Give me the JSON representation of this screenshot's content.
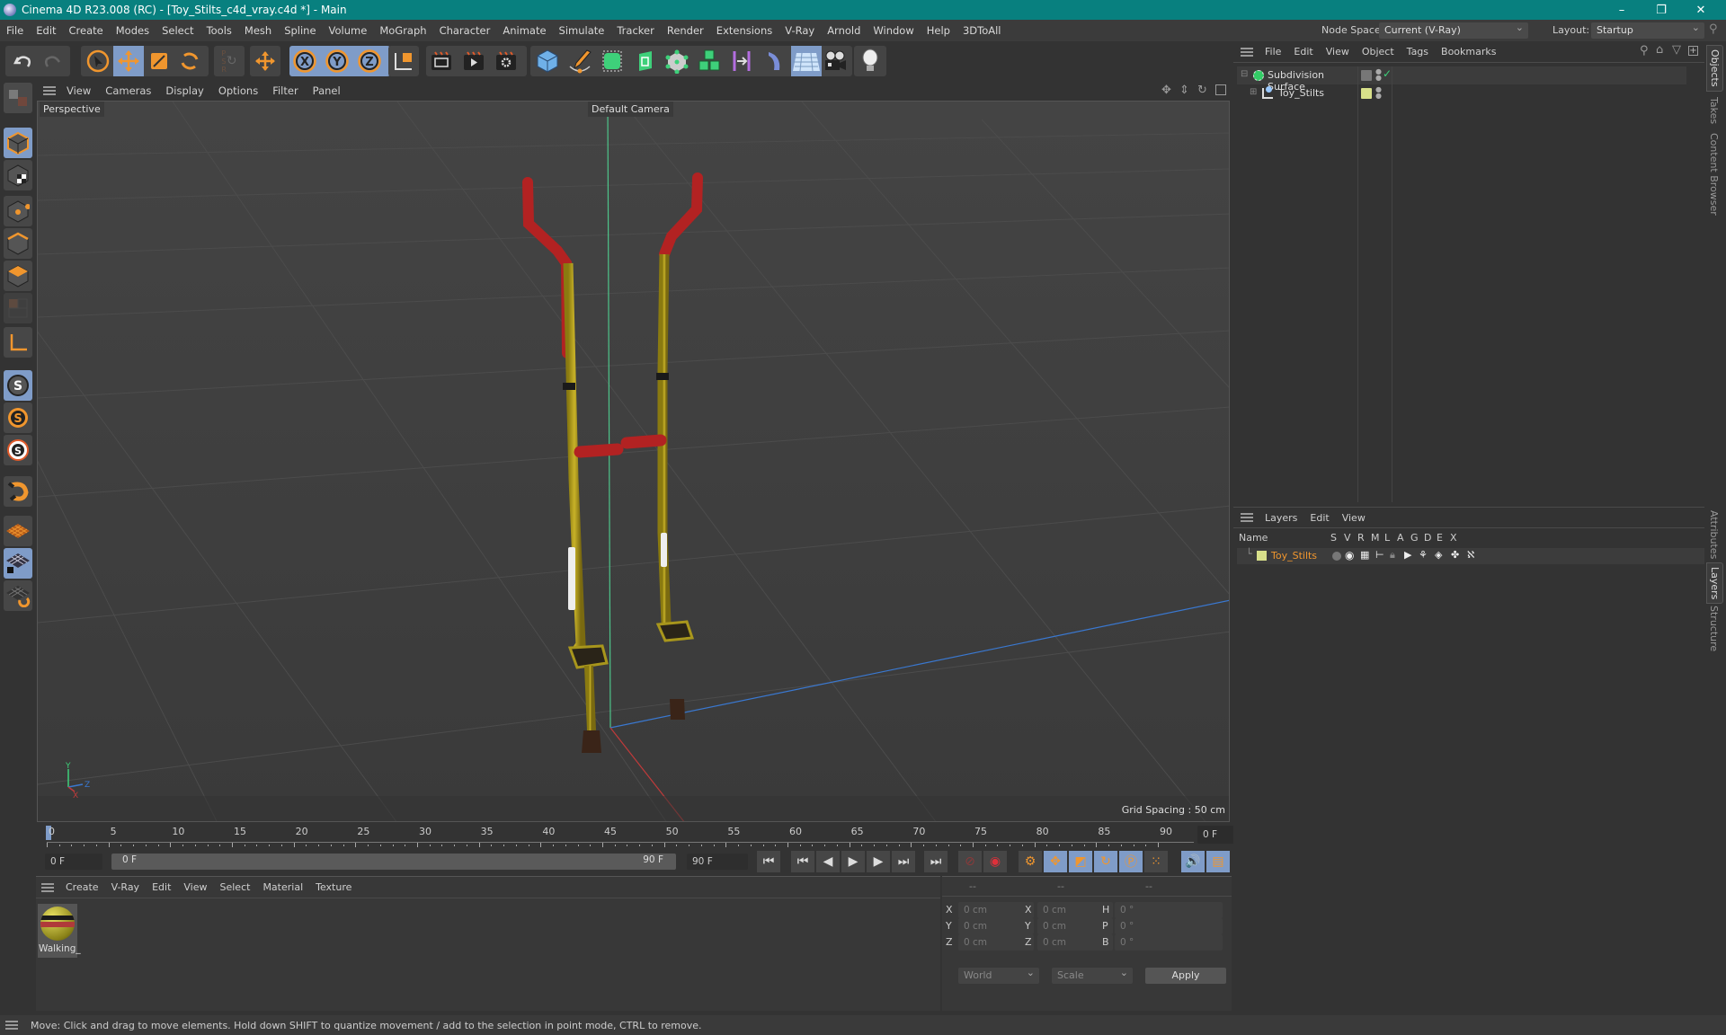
{
  "titlebar": {
    "title": "Cinema 4D R23.008 (RC) - [Toy_Stilts_c4d_vray.c4d *] - Main",
    "minimize": "–",
    "restore": "❐",
    "close": "✕"
  },
  "menubar": {
    "items": [
      "File",
      "Edit",
      "Create",
      "Modes",
      "Select",
      "Tools",
      "Mesh",
      "Spline",
      "Volume",
      "MoGraph",
      "Character",
      "Animate",
      "Simulate",
      "Tracker",
      "Render",
      "Extensions",
      "V-Ray",
      "Arnold",
      "Window",
      "Help",
      "3DToAll"
    ],
    "node_space_label": "Node Space:",
    "node_space_value": "Current (V-Ray)",
    "layout_label": "Layout:",
    "layout_value": "Startup"
  },
  "toolbar": {
    "icons": [
      "undo-icon",
      "redo-icon",
      "select-icon",
      "move-icon",
      "scale-icon",
      "rotate-icon",
      "psr-icon",
      "live-move-icon",
      "x-axis-icon",
      "y-axis-icon",
      "z-axis-icon",
      "coordinate-system-icon",
      "render-region-icon",
      "render-view-icon",
      "render-settings-icon",
      "cube-icon",
      "pen-icon",
      "subdivision-icon",
      "extrude-icon",
      "cloner-icon",
      "array-icon",
      "symmetry-icon",
      "deformer-icon",
      "floor-icon",
      "camera-icon",
      "light-icon"
    ],
    "axis_x": "X",
    "axis_y": "Y",
    "axis_z": "Z"
  },
  "left_tools": [
    "model-mode-icon",
    "texture-mode-icon",
    "point-mode-icon",
    "edge-mode-icon",
    "polygon-mode-icon",
    "uv-mode-icon",
    "axis-mode-icon",
    "snap-icon",
    "snap-settings-icon",
    "snap-workplane-icon",
    "magnet-icon",
    "workplane-icon",
    "locked-workplane-icon",
    "workplane-align-icon"
  ],
  "viewport": {
    "menu": [
      "View",
      "Cameras",
      "Display",
      "Options",
      "Filter",
      "Panel"
    ],
    "label": "Perspective",
    "camera": "Default Camera",
    "grid_spacing": "Grid Spacing : 50 cm",
    "axis_x": "X",
    "axis_y": "Y",
    "axis_z": "Z"
  },
  "timeline": {
    "ticks": [
      "0",
      "5",
      "10",
      "15",
      "20",
      "25",
      "30",
      "35",
      "40",
      "45",
      "50",
      "55",
      "60",
      "65",
      "70",
      "75",
      "80",
      "85",
      "90"
    ],
    "current_frame": "0 F",
    "start_field": "0 F",
    "range_start": "0 F",
    "range_end": "90 F",
    "end_field": "90 F",
    "frame_display": "0 F"
  },
  "materials": {
    "menu": [
      "Create",
      "V-Ray",
      "Edit",
      "View",
      "Select",
      "Material",
      "Texture"
    ],
    "items": [
      {
        "name": "Walking_"
      }
    ]
  },
  "coordinates": {
    "headers": [
      "--",
      "--",
      "--"
    ],
    "rows": [
      {
        "l1": "X",
        "v1": "0 cm",
        "l2": "X",
        "v2": "0 cm",
        "l3": "H",
        "v3": "0 °"
      },
      {
        "l1": "Y",
        "v1": "0 cm",
        "l2": "Y",
        "v2": "0 cm",
        "l3": "P",
        "v3": "0 °"
      },
      {
        "l1": "Z",
        "v1": "0 cm",
        "l2": "Z",
        "v2": "0 cm",
        "l3": "B",
        "v3": "0 °"
      }
    ],
    "mode": "World",
    "transform": "Scale",
    "apply": "Apply"
  },
  "objects": {
    "menu": [
      "File",
      "Edit",
      "View",
      "Object",
      "Tags",
      "Bookmarks"
    ],
    "items": [
      {
        "name": "Subdivision Surface",
        "color": "#33cc66"
      },
      {
        "name": "Toy_Stilts",
        "color": "#99c8ff"
      }
    ]
  },
  "layers": {
    "menu": [
      "Layers",
      "Edit",
      "View"
    ],
    "columns": [
      "Name",
      "S",
      "V",
      "R",
      "M",
      "L",
      "A",
      "G",
      "D",
      "E",
      "X"
    ],
    "items": [
      {
        "name": "Toy_Stilts",
        "color": "#d8e08a"
      }
    ]
  },
  "side_tabs": [
    "Objects",
    "Takes",
    "Content Browser",
    "Attributes",
    "Layers",
    "Structure"
  ],
  "statusbar": {
    "text": "Move: Click and drag to move elements. Hold down SHIFT to quantize movement / add to the selection in point mode, CTRL to remove."
  },
  "colors": {
    "accent": "#f0962e",
    "selected": "#7f9cc8",
    "titlebar": "#08807f",
    "stilt_yellow": "#b8a321",
    "stilt_red": "#c02828"
  }
}
